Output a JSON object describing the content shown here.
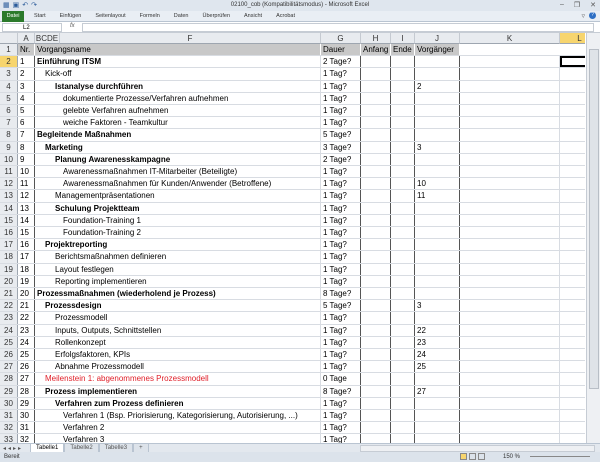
{
  "window": {
    "title": "02100_cob (Kompatibilitätsmodus) - Microsoft Excel",
    "controls": [
      "–",
      "❐",
      "✕"
    ]
  },
  "ribbon": {
    "file": "Datei",
    "tabs": [
      "Start",
      "Einfügen",
      "Seitenlayout",
      "Formeln",
      "Daten",
      "Überprüfen",
      "Ansicht",
      "Acrobat"
    ]
  },
  "formula_bar": {
    "name_box": "L2",
    "fx": "fx",
    "value": ""
  },
  "columns": [
    "A",
    "BCDE",
    "F",
    "G",
    "H",
    "I",
    "J",
    "K",
    "L"
  ],
  "header": {
    "nr": "Nr.",
    "name": "Vorgangsname",
    "dauer": "Dauer",
    "anfang": "Anfang",
    "ende": "Ende",
    "vorgaenger": "Vorgänger"
  },
  "rows": [
    {
      "nr": "1",
      "name": "Einführung ITSM",
      "level": 0,
      "bold": true,
      "dauer": "2 Tage?",
      "vorg": ""
    },
    {
      "nr": "2",
      "name": "Kick-off",
      "level": 1,
      "bold": false,
      "dauer": "1 Tag?",
      "vorg": ""
    },
    {
      "nr": "3",
      "name": "Istanalyse durchführen",
      "level": 2,
      "bold": true,
      "dauer": "1 Tag?",
      "vorg": "2"
    },
    {
      "nr": "4",
      "name": "dokumentierte Prozesse/Verfahren aufnehmen",
      "level": 3,
      "bold": false,
      "dauer": "1 Tag?",
      "vorg": ""
    },
    {
      "nr": "5",
      "name": "gelebte Verfahren aufnehmen",
      "level": 3,
      "bold": false,
      "dauer": "1 Tag?",
      "vorg": ""
    },
    {
      "nr": "6",
      "name": "weiche Faktoren - Teamkultur",
      "level": 3,
      "bold": false,
      "dauer": "1 Tag?",
      "vorg": ""
    },
    {
      "nr": "7",
      "name": "Begleitende Maßnahmen",
      "level": 0,
      "bold": true,
      "dauer": "5 Tage?",
      "vorg": ""
    },
    {
      "nr": "8",
      "name": "Marketing",
      "level": 1,
      "bold": true,
      "dauer": "3 Tage?",
      "vorg": "3"
    },
    {
      "nr": "9",
      "name": "Planung Awarenesskampagne",
      "level": 2,
      "bold": true,
      "dauer": "2 Tage?",
      "vorg": ""
    },
    {
      "nr": "10",
      "name": "Awarenessmaßnahmen IT-Mitarbeiter (Beteiligte)",
      "level": 3,
      "bold": false,
      "dauer": "1 Tag?",
      "vorg": ""
    },
    {
      "nr": "11",
      "name": "Awarenessmaßnahmen für Kunden/Anwender (Betroffene)",
      "level": 3,
      "bold": false,
      "dauer": "1 Tag?",
      "vorg": "10"
    },
    {
      "nr": "12",
      "name": "Managementpräsentationen",
      "level": 2,
      "bold": false,
      "dauer": "1 Tag?",
      "vorg": "11"
    },
    {
      "nr": "13",
      "name": "Schulung Projektteam",
      "level": 2,
      "bold": true,
      "dauer": "1 Tag?",
      "vorg": ""
    },
    {
      "nr": "14",
      "name": "Foundation-Training 1",
      "level": 3,
      "bold": false,
      "dauer": "1 Tag?",
      "vorg": ""
    },
    {
      "nr": "15",
      "name": "Foundation-Training 2",
      "level": 3,
      "bold": false,
      "dauer": "1 Tag?",
      "vorg": ""
    },
    {
      "nr": "16",
      "name": "Projektreporting",
      "level": 1,
      "bold": true,
      "dauer": "1 Tag?",
      "vorg": ""
    },
    {
      "nr": "17",
      "name": "Berichtsmaßnahmen definieren",
      "level": 2,
      "bold": false,
      "dauer": "1 Tag?",
      "vorg": ""
    },
    {
      "nr": "18",
      "name": "Layout festlegen",
      "level": 2,
      "bold": false,
      "dauer": "1 Tag?",
      "vorg": ""
    },
    {
      "nr": "19",
      "name": "Reporting implementieren",
      "level": 2,
      "bold": false,
      "dauer": "1 Tag?",
      "vorg": ""
    },
    {
      "nr": "20",
      "name": "Prozessmaßnahmen (wiederholend je Prozess)",
      "level": 0,
      "bold": true,
      "dauer": "8 Tage?",
      "vorg": ""
    },
    {
      "nr": "21",
      "name": "Prozessdesign",
      "level": 1,
      "bold": true,
      "dauer": "5 Tage?",
      "vorg": "3"
    },
    {
      "nr": "22",
      "name": "Prozessmodell",
      "level": 2,
      "bold": false,
      "dauer": "1 Tag?",
      "vorg": ""
    },
    {
      "nr": "23",
      "name": "Inputs, Outputs, Schnittstellen",
      "level": 2,
      "bold": false,
      "dauer": "1 Tag?",
      "vorg": "22"
    },
    {
      "nr": "24",
      "name": "Rollenkonzept",
      "level": 2,
      "bold": false,
      "dauer": "1 Tag?",
      "vorg": "23"
    },
    {
      "nr": "25",
      "name": "Erfolgsfaktoren, KPIs",
      "level": 2,
      "bold": false,
      "dauer": "1 Tag?",
      "vorg": "24"
    },
    {
      "nr": "26",
      "name": "Abnahme Prozessmodell",
      "level": 2,
      "bold": false,
      "dauer": "1 Tag?",
      "vorg": "25"
    },
    {
      "nr": "27",
      "name": "Meilenstein 1: abgenommenes Prozessmodell",
      "level": 1,
      "bold": false,
      "red": true,
      "dauer": "0 Tage",
      "vorg": ""
    },
    {
      "nr": "28",
      "name": "Prozess implementieren",
      "level": 1,
      "bold": true,
      "dauer": "8 Tage?",
      "vorg": "27"
    },
    {
      "nr": "29",
      "name": "Verfahren zum Prozess definieren",
      "level": 2,
      "bold": true,
      "dauer": "1 Tag?",
      "vorg": ""
    },
    {
      "nr": "30",
      "name": "Verfahren 1 (Bsp. Priorisierung, Kategorisierung, Autorisierung, ...)",
      "level": 3,
      "bold": false,
      "dauer": "1 Tag?",
      "vorg": ""
    },
    {
      "nr": "31",
      "name": "Verfahren 2",
      "level": 3,
      "bold": false,
      "dauer": "1 Tag?",
      "vorg": ""
    },
    {
      "nr": "32",
      "name": "Verfahren 3",
      "level": 3,
      "bold": false,
      "dauer": "1 Tag?",
      "vorg": ""
    }
  ],
  "sheets": [
    "Tabelle1",
    "Tabelle2",
    "Tabelle3"
  ],
  "status": {
    "text": "Bereit",
    "zoom": "150 %"
  },
  "colors": {
    "selected_header": "#f7d56e",
    "milestone": "#e0202a",
    "file_tab": "#2b7a2b"
  }
}
